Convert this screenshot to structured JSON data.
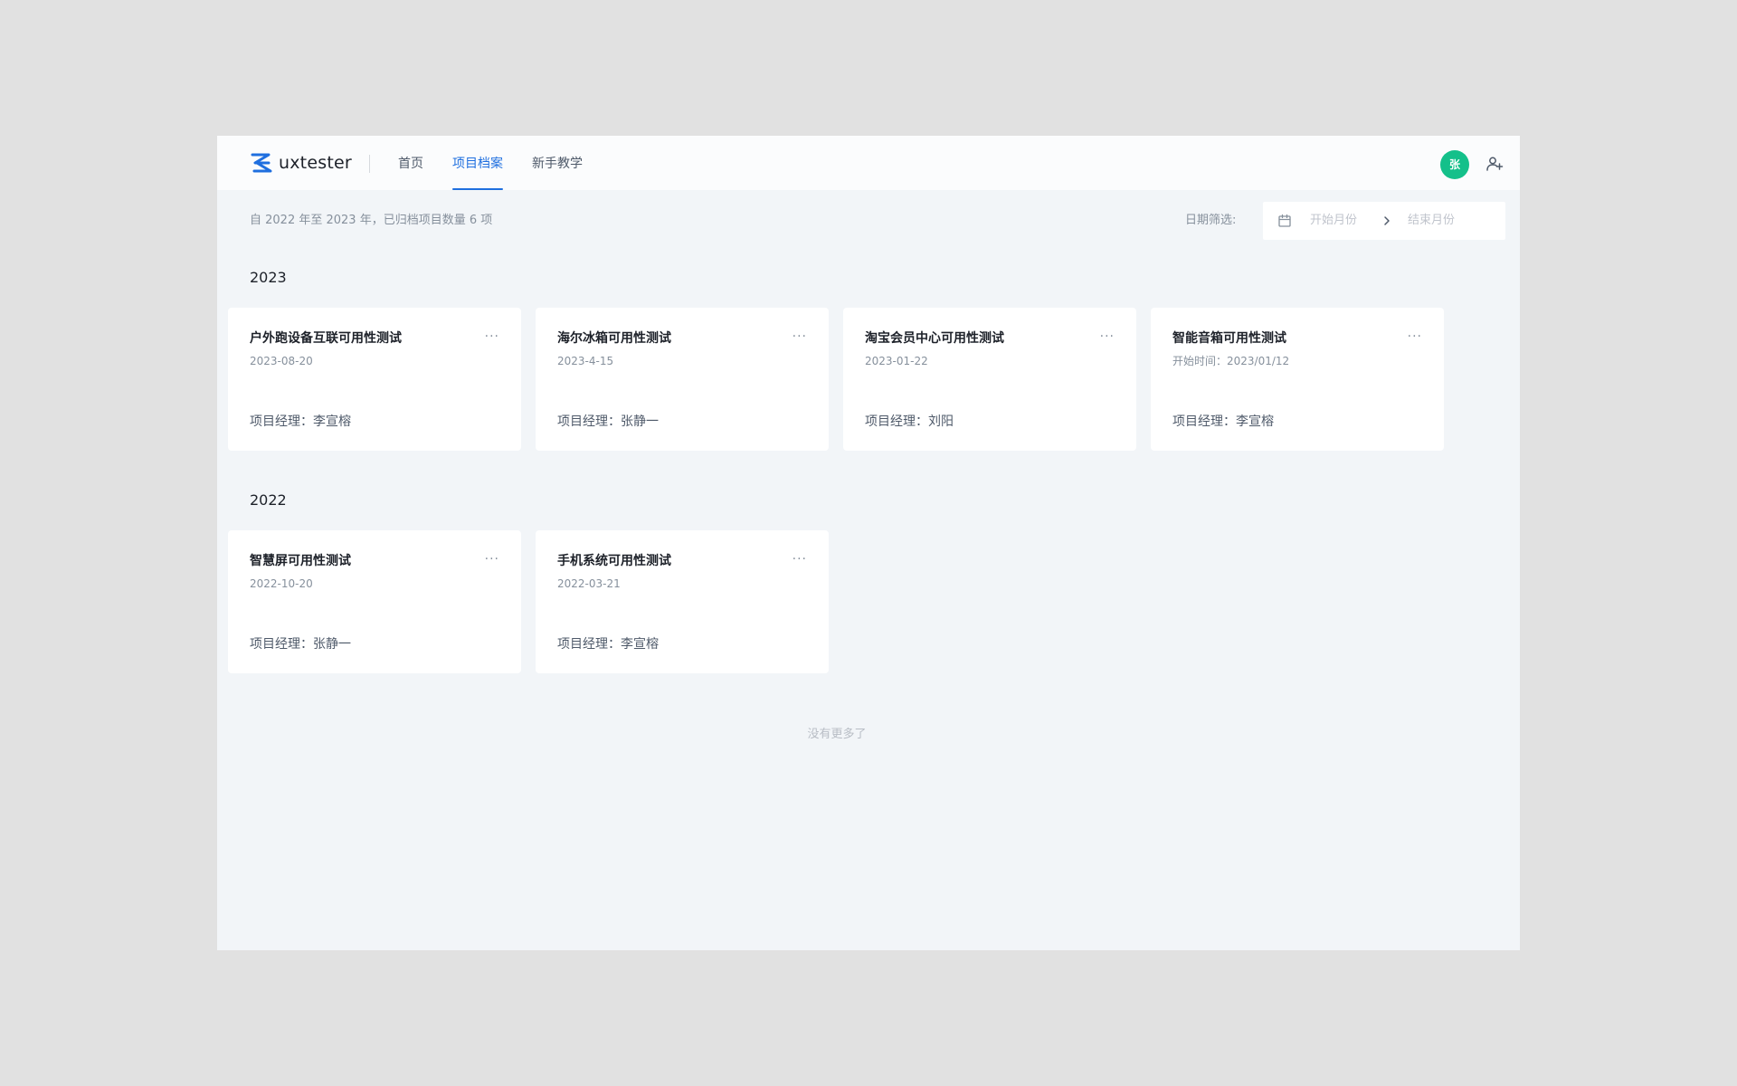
{
  "app": {
    "name": "uxtester",
    "brand_color": "#1f6fdf",
    "avatar_color": "#14c08a"
  },
  "header": {
    "nav": [
      {
        "label": "首页",
        "active": false
      },
      {
        "label": "项目档案",
        "active": true
      },
      {
        "label": "新手教学",
        "active": false
      }
    ],
    "avatar_text": "张",
    "add_user_icon": "add-user-icon"
  },
  "summary": {
    "text": "自 2022 年至 2023 年，已归档项目数量 6 项"
  },
  "filter": {
    "label": "日期筛选:",
    "start_placeholder": "开始月份",
    "end_placeholder": "结束月份",
    "calendar_icon": "calendar-icon",
    "separator_icon": "chevron-right-icon"
  },
  "sections": [
    {
      "year": "2023",
      "cards": [
        {
          "title": "户外跑设备互联可用性测试",
          "date": "2023-08-20",
          "manager": "项目经理：李宣榕",
          "more": "···"
        },
        {
          "title": "海尔冰箱可用性测试",
          "date": "2023-4-15",
          "manager": "项目经理：张静一",
          "more": "···"
        },
        {
          "title": "淘宝会员中心可用性测试",
          "date": "2023-01-22",
          "manager": "项目经理：刘阳",
          "more": "···"
        },
        {
          "title": "智能音箱可用性测试",
          "date": "开始时间：2023/01/12",
          "manager": "项目经理：李宣榕",
          "more": "···"
        }
      ]
    },
    {
      "year": "2022",
      "cards": [
        {
          "title": "智慧屏可用性测试",
          "date": "2022-10-20",
          "manager": "项目经理：张静一",
          "more": "···"
        },
        {
          "title": "手机系统可用性测试",
          "date": "2022-03-21",
          "manager": "项目经理：李宣榕",
          "more": "···"
        }
      ]
    }
  ],
  "footer": {
    "no_more": "没有更多了"
  }
}
